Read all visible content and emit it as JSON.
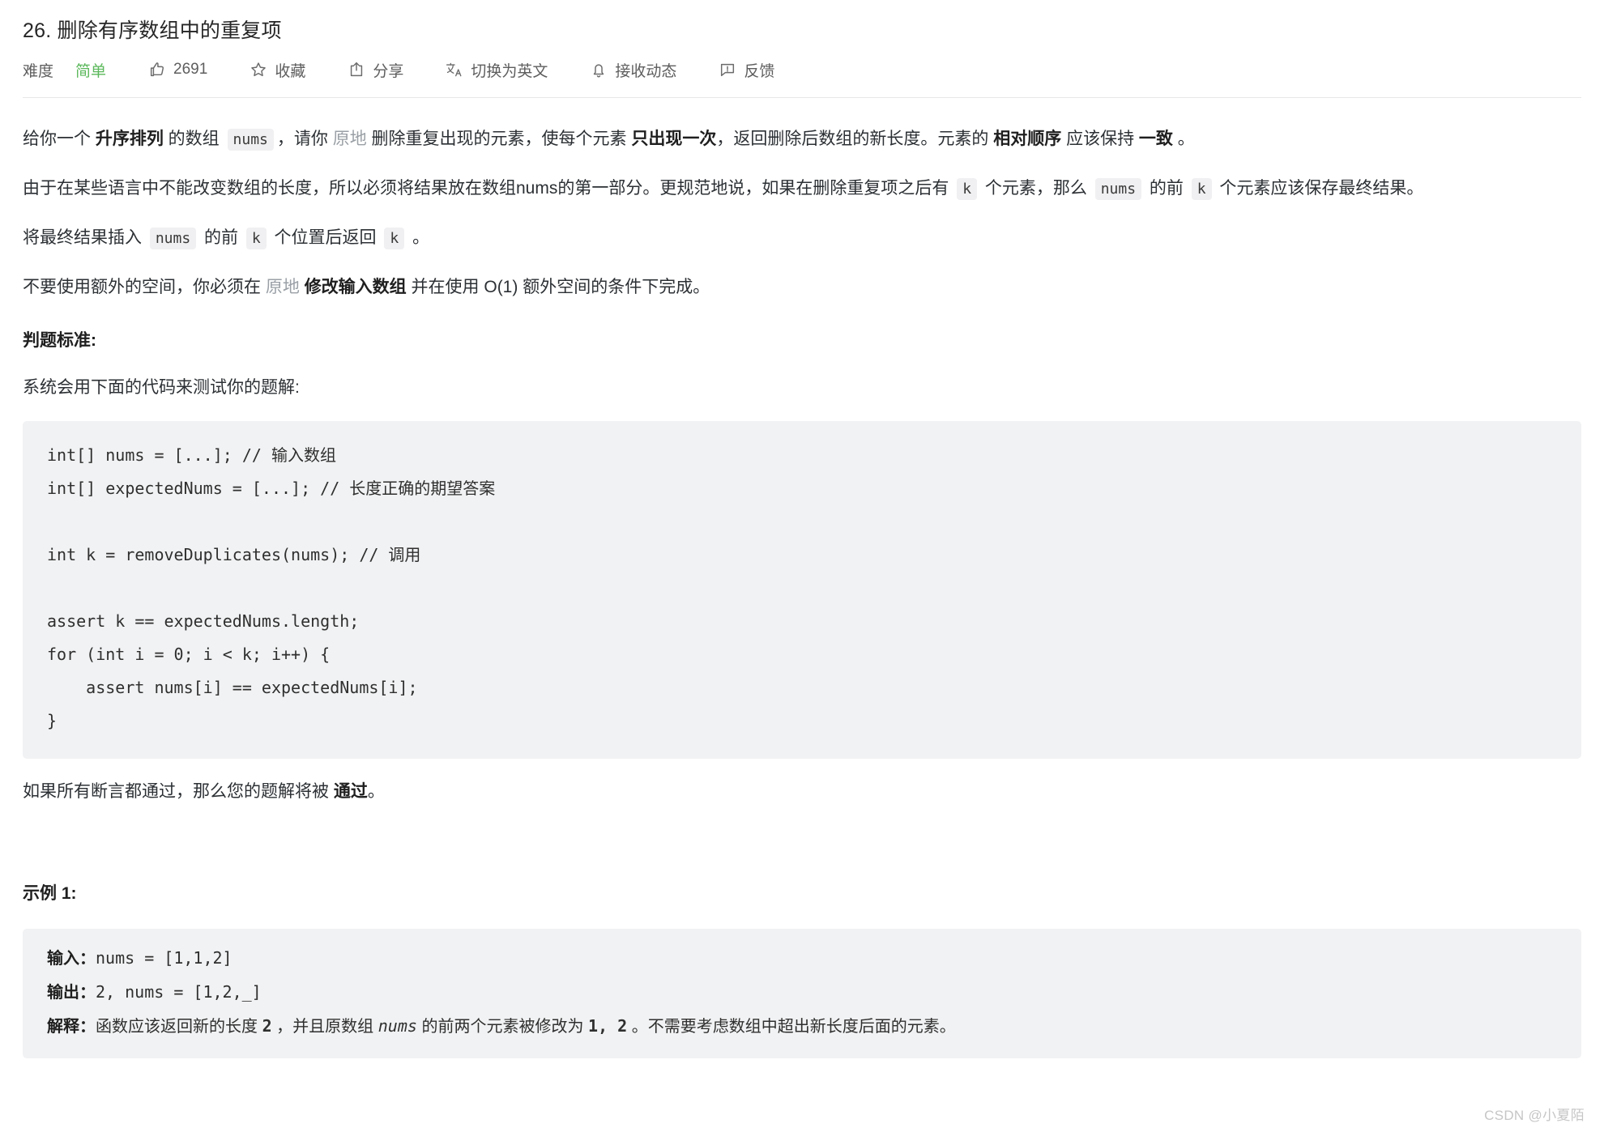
{
  "problem": {
    "title": "26. 删除有序数组中的重复项"
  },
  "toolbar": {
    "difficulty_label": "难度",
    "difficulty_value": "简单",
    "like_icon": "thumbs-up-icon",
    "like_count": "2691",
    "favorite_icon": "star-icon",
    "favorite_label": "收藏",
    "share_icon": "share-icon",
    "share_label": "分享",
    "translate_icon": "translate-icon",
    "translate_label": "切换为英文",
    "subscribe_icon": "bell-icon",
    "subscribe_label": "接收动态",
    "feedback_icon": "feedback-icon",
    "feedback_label": "反馈",
    "difficulty_color": "#5cb85c"
  },
  "description": {
    "p1": {
      "s1": "给你一个 ",
      "bold1": "升序排列",
      "s2": " 的数组 ",
      "code1": "nums",
      "s3": "，请你 ",
      "muted1": "原地",
      "s4": " 删除重复出现的元素，使每个元素 ",
      "bold2": "只出现一次",
      "s5": "，返回删除后数组的新长度。元素的 ",
      "bold3": "相对顺序",
      "s6": " 应该保持 ",
      "bold4": "一致",
      "s7": " 。"
    },
    "p2": {
      "s1": "由于在某些语言中不能改变数组的长度，所以必须将结果放在数组nums的第一部分。更规范地说，如果在删除重复项之后有 ",
      "code1": "k",
      "s2": " 个元素，那么 ",
      "code2": "nums",
      "s3": " 的前 ",
      "code3": "k",
      "s4": " 个元素应该保存最终结果。"
    },
    "p3": {
      "s1": "将最终结果插入 ",
      "code1": "nums",
      "s2": " 的前 ",
      "code2": "k",
      "s3": " 个位置后返回 ",
      "code3": "k",
      "s4": " 。"
    },
    "p4": {
      "s1": "不要使用额外的空间，你必须在 ",
      "muted1": "原地",
      "s2": " ",
      "bold1": "修改输入数组",
      "s3": " 并在使用 O(1) 额外空间的条件下完成。"
    },
    "judge_heading": "判题标准:",
    "p5": "系统会用下面的代码来测试你的题解:",
    "code_block": "int[] nums = [...]; // 输入数组\nint[] expectedNums = [...]; // 长度正确的期望答案\n\nint k = removeDuplicates(nums); // 调用\n\nassert k == expectedNums.length;\nfor (int i = 0; i < k; i++) {\n    assert nums[i] == expectedNums[i];\n}",
    "p6": {
      "s1": "如果所有断言都通过，那么您的题解将被 ",
      "bold1": "通过",
      "s2": "。"
    }
  },
  "example": {
    "heading_prefix": "示例 ",
    "heading_num": "1",
    "heading_suffix": ":",
    "input_label": "输入：",
    "input_value": "nums = [1,1,2]",
    "output_label": "输出：",
    "output_value": "2, nums = [1,2,_]",
    "explain_label": "解释：",
    "explain_part1": "函数应该返回新的长度 ",
    "explain_bold1": "2",
    "explain_part2": " ，并且原数组 ",
    "explain_italic": "nums",
    "explain_part3": " 的前两个元素被修改为 ",
    "explain_bold2": "1, 2",
    "explain_part4": " 。不需要考虑数组中超出新长度后面的元素。"
  },
  "watermark": {
    "text": "CSDN @小夏陌"
  }
}
